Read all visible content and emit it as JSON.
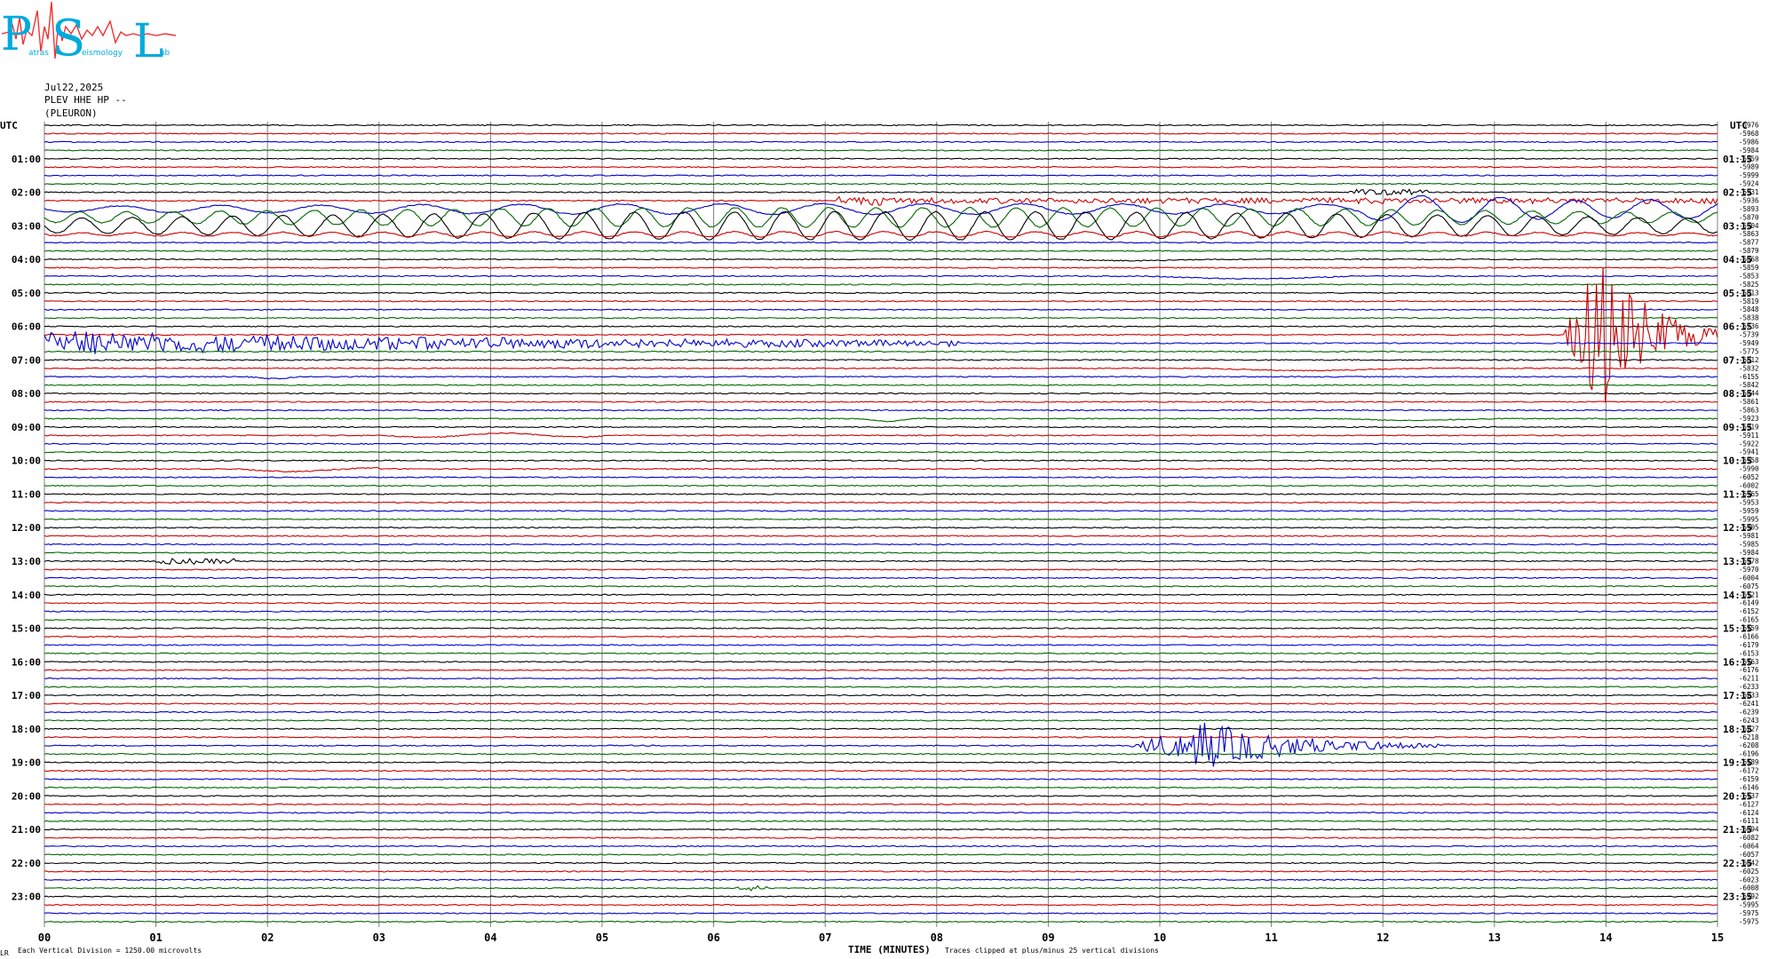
{
  "header": {
    "logo_letters": [
      "P",
      "S",
      "L"
    ],
    "logo_words": [
      "atras",
      "eismology",
      "ab"
    ],
    "date": "Jul22,2025",
    "station_line": "PLEV HHE HP --",
    "station_name": "(PLEURON)"
  },
  "colors": {
    "trace_cycle": [
      "#000000",
      "#cc0000",
      "#0000cc",
      "#006600"
    ],
    "grid": "#808080",
    "logo_cyan": "#00aadd",
    "logo_red": "#ee3333"
  },
  "chart_data": {
    "type": "line",
    "title": "",
    "xlabel": "TIME (MINUTES)",
    "ylabel": "",
    "xlim": [
      0,
      15
    ],
    "x_ticks": [
      "00",
      "01",
      "02",
      "03",
      "04",
      "05",
      "06",
      "07",
      "08",
      "09",
      "10",
      "11",
      "12",
      "13",
      "14",
      "15"
    ],
    "left_axis_label": "UTC",
    "right_axis_label": "UTC",
    "left_hour_labels": [
      "01:00",
      "02:00",
      "03:00",
      "04:00",
      "05:00",
      "06:00",
      "07:00",
      "08:00",
      "09:00",
      "10:00",
      "11:00",
      "12:00",
      "13:00",
      "14:00",
      "15:00",
      "16:00",
      "17:00",
      "18:00",
      "19:00",
      "20:00",
      "21:00",
      "22:00",
      "23:00"
    ],
    "right_hour_labels": [
      "01:15",
      "02:15",
      "03:15",
      "04:15",
      "05:15",
      "06:15",
      "07:15",
      "08:15",
      "09:15",
      "10:15",
      "11:15",
      "12:15",
      "13:15",
      "14:15",
      "15:15",
      "16:15",
      "17:15",
      "18:15",
      "19:15",
      "20:15",
      "21:15",
      "22:15",
      "23:15"
    ],
    "trace_count": 96,
    "trace_minutes": 15,
    "trace_offsets": [
      -5976,
      -5968,
      -5986,
      -5984,
      -5959,
      -5989,
      -5999,
      -5924,
      -5931,
      -5936,
      -5893,
      -5870,
      -5904,
      -5863,
      -5877,
      -5879,
      -5868,
      -5859,
      -5853,
      -5825,
      -5813,
      -5819,
      -5848,
      -5838,
      -5736,
      -5739,
      -5949,
      -5775,
      -5812,
      -5832,
      -6155,
      -5842,
      -5844,
      -5861,
      -5863,
      -5923,
      -5919,
      -5911,
      -5922,
      -5941,
      -5958,
      -5990,
      -6052,
      -6002,
      -5965,
      -5953,
      -5959,
      -5995,
      -5905,
      -5981,
      -5985,
      -5984,
      -5978,
      -5970,
      -6004,
      -6075,
      -6121,
      -6149,
      -6152,
      -6165,
      -6159,
      -6166,
      -6179,
      -6153,
      -6163,
      -6176,
      -6211,
      -6233,
      -6233,
      -6241,
      -6239,
      -6243,
      -6227,
      -6218,
      -6208,
      -6196,
      -6189,
      -6172,
      -6159,
      -6146,
      -6137,
      -6127,
      -6124,
      -6111,
      -6094,
      -6082,
      -6064,
      -6057,
      -6042,
      -6025,
      -6023,
      -6008,
      -5992,
      -5995,
      -5975,
      -5975
    ],
    "events": [
      {
        "trace": 8,
        "start_min": 11.7,
        "end_min": 12.4,
        "amp": 3.0,
        "period": 0.02,
        "kind": "noise"
      },
      {
        "trace": 9,
        "start_min": 7.1,
        "end_min": 7.5,
        "amp": 5.0,
        "period": 0.05,
        "kind": "noise"
      },
      {
        "trace": 9,
        "start_min": 7.5,
        "end_min": 15.0,
        "amp": 3.0,
        "period": 0.12,
        "kind": "noise"
      },
      {
        "trace": 10,
        "start_min": 0.0,
        "end_min": 15.0,
        "amp": 6.0,
        "period": 0.9,
        "kind": "swell"
      },
      {
        "trace": 10,
        "start_min": 11.8,
        "end_min": 15.0,
        "amp": 14.0,
        "period": 0.7,
        "kind": "swell"
      },
      {
        "trace": 11,
        "start_min": 0.0,
        "end_min": 15.0,
        "amp": 11.0,
        "period": 0.42,
        "kind": "swell"
      },
      {
        "trace": 12,
        "start_min": 0.0,
        "end_min": 15.0,
        "amp": 16.0,
        "period": 0.45,
        "kind": "swell"
      },
      {
        "trace": 13,
        "start_min": 0.0,
        "end_min": 15.0,
        "amp": 3.0,
        "period": 0.45,
        "kind": "swell"
      },
      {
        "trace": 16,
        "start_min": 9.0,
        "end_min": 10.5,
        "amp": 1.5,
        "period": 3.0,
        "kind": "swell"
      },
      {
        "trace": 18,
        "start_min": 9.8,
        "end_min": 12.0,
        "amp": 3.0,
        "period": 4.0,
        "kind": "swell"
      },
      {
        "trace": 26,
        "start_min": 0.0,
        "end_min": 8.2,
        "amp": 14.0,
        "period": 0.06,
        "kind": "decay"
      },
      {
        "trace": 25,
        "start_min": 13.6,
        "end_min": 15.0,
        "amp": 90.0,
        "period": 0.04,
        "kind": "quake"
      },
      {
        "trace": 29,
        "start_min": 10.3,
        "end_min": 12.5,
        "amp": 2.5,
        "period": 4.0,
        "kind": "swell"
      },
      {
        "trace": 30,
        "start_min": 1.8,
        "end_min": 2.4,
        "amp": 2.0,
        "period": 1.0,
        "kind": "swell"
      },
      {
        "trace": 35,
        "start_min": 7.3,
        "end_min": 7.9,
        "amp": 3.0,
        "period": 1.0,
        "kind": "swell"
      },
      {
        "trace": 35,
        "start_min": 11.5,
        "end_min": 13.0,
        "amp": 2.0,
        "period": 3.0,
        "kind": "swell"
      },
      {
        "trace": 37,
        "start_min": 3.0,
        "end_min": 5.0,
        "amp": 2.5,
        "period": 1.5,
        "kind": "swell"
      },
      {
        "trace": 41,
        "start_min": 1.7,
        "end_min": 3.0,
        "amp": 3.0,
        "period": 2.0,
        "kind": "swell"
      },
      {
        "trace": 52,
        "start_min": 1.0,
        "end_min": 1.7,
        "amp": 3.0,
        "period": 0.03,
        "kind": "noise"
      },
      {
        "trace": 74,
        "start_min": 9.7,
        "end_min": 12.5,
        "amp": 26.0,
        "period": 0.04,
        "kind": "quake"
      },
      {
        "trace": 91,
        "start_min": 6.2,
        "end_min": 6.5,
        "amp": 3.0,
        "period": 0.05,
        "kind": "noise"
      }
    ]
  },
  "footer": {
    "left_mark": "LR",
    "scale_note": "Each Vertical Division = 1250.00 microvolts",
    "clip_note": "Traces clipped at plus/minus 25 vertical divisions"
  }
}
